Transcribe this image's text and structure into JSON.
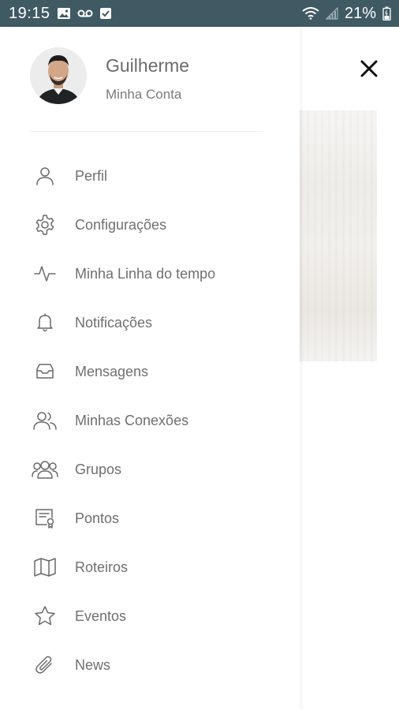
{
  "status_bar": {
    "time": "19:15",
    "battery": "21%",
    "icons": [
      "image-icon",
      "voicemail-icon",
      "checkbox-icon",
      "wifi-icon",
      "signal-icon",
      "battery-icon"
    ],
    "background_color": "#3f5a63"
  },
  "profile": {
    "name": "Guilherme",
    "subtitle": "Minha Conta"
  },
  "menu": {
    "items": [
      {
        "label": "Perfil",
        "icon": "user-icon"
      },
      {
        "label": "Configurações",
        "icon": "gear-icon"
      },
      {
        "label": "Minha Linha do tempo",
        "icon": "activity-icon"
      },
      {
        "label": "Notificações",
        "icon": "bell-icon"
      },
      {
        "label": "Mensagens",
        "icon": "inbox-icon"
      },
      {
        "label": "Minhas Conexões",
        "icon": "users-icon"
      },
      {
        "label": "Grupos",
        "icon": "group-icon"
      },
      {
        "label": "Pontos",
        "icon": "certificate-icon"
      },
      {
        "label": "Roteiros",
        "icon": "map-icon"
      },
      {
        "label": "Eventos",
        "icon": "star-icon"
      },
      {
        "label": "News",
        "icon": "paperclip-icon"
      }
    ]
  },
  "colors": {
    "text": "#6f6f6f",
    "icon": "#6a6a6a",
    "close": "#111111"
  }
}
